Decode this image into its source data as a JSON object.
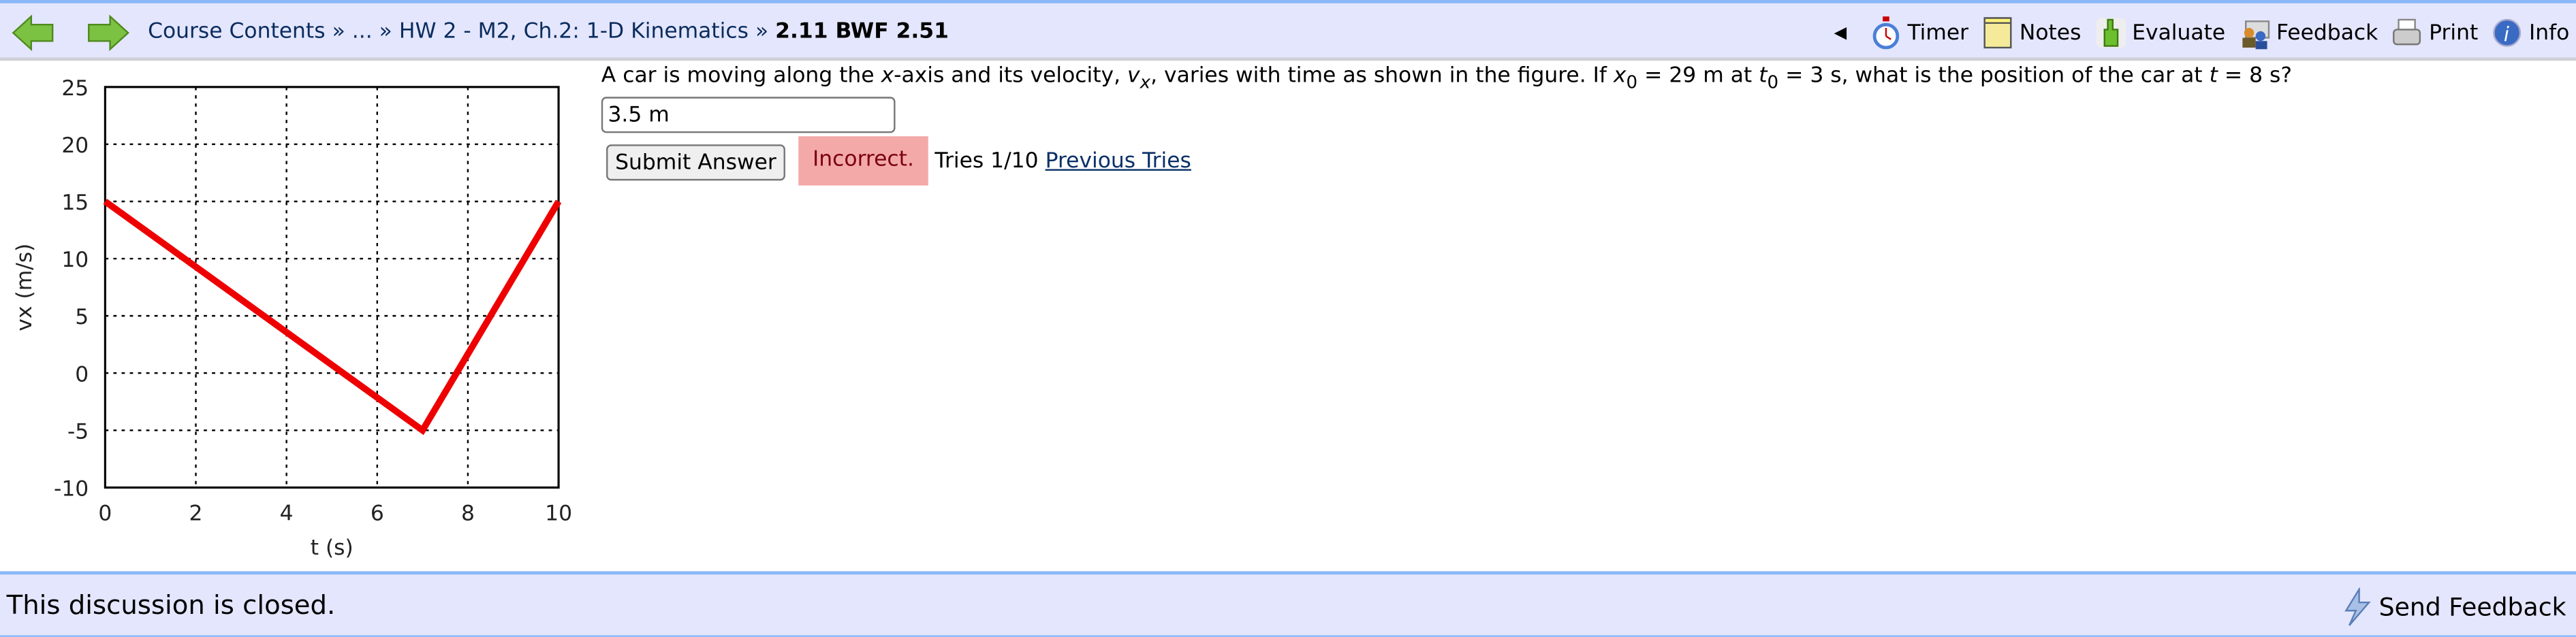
{
  "nav": {
    "back_icon": "green-left-arrow-icon",
    "forward_icon": "green-right-arrow-icon",
    "breadcrumb": [
      "Course Contents",
      "...",
      "HW 2 - M2, Ch.2: 1-D Kinematics"
    ],
    "separator": "»",
    "current": "2.11 BWF 2.51"
  },
  "tools": [
    {
      "label": "Timer",
      "icon": "stopwatch-icon"
    },
    {
      "label": "Notes",
      "icon": "notepad-icon"
    },
    {
      "label": "Evaluate",
      "icon": "thumbs-up-icon"
    },
    {
      "label": "Feedback",
      "icon": "feedback-people-icon"
    },
    {
      "label": "Print",
      "icon": "printer-icon"
    },
    {
      "label": "Info",
      "icon": "info-icon"
    }
  ],
  "question": {
    "p1": "A car is moving along the ",
    "x": "x",
    "p2": "-axis and its velocity, ",
    "v": "v",
    "vsub": "x",
    "p3": ", varies with time as shown in the figure. If ",
    "x0": "x",
    "x0sub": "0",
    "p4": " = 29 m at ",
    "t0": "t",
    "t0sub": "0",
    "p5": " = 3 s, what is the position of the car at ",
    "t": "t",
    "p6": " = 8 s?"
  },
  "answer": {
    "value": "3.5 m"
  },
  "submit_label": "Submit Answer",
  "status": {
    "text": "Incorrect.",
    "bg": "#f4a9a9"
  },
  "tries": "Tries 1/10",
  "previous_tries": "Previous Tries",
  "footer": {
    "closed": "This discussion is closed.",
    "send_feedback": "Send Feedback"
  },
  "chart_data": {
    "type": "line",
    "xlabel": "t (s)",
    "ylabel": "vx (m/s)",
    "xlim": [
      0,
      10
    ],
    "ylim": [
      -10,
      25
    ],
    "xticks": [
      0,
      2,
      4,
      6,
      8,
      10
    ],
    "yticks": [
      -10,
      -5,
      0,
      5,
      10,
      15,
      20,
      25
    ],
    "grid": true,
    "series": [
      {
        "x": [
          0,
          7,
          10
        ],
        "y": [
          15,
          -5,
          15
        ],
        "color": "#ee0000"
      }
    ]
  }
}
